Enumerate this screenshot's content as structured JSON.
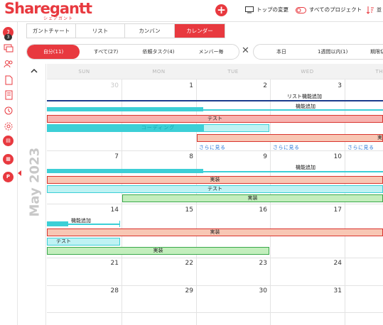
{
  "header": {
    "logo": "Sharegantt",
    "logo_sub": "シェアガント",
    "top_change_label": "トップの変更",
    "all_projects_label": "すべてのプロジェクト",
    "sort_label": "並"
  },
  "rail": {
    "badge_count": "3",
    "project_initial": "P"
  },
  "view_tabs": [
    {
      "label": "ガントチャート",
      "active": false
    },
    {
      "label": "リスト",
      "active": false
    },
    {
      "label": "カンバン",
      "active": false
    },
    {
      "label": "カレンダー",
      "active": true
    }
  ],
  "filter_tabs": [
    {
      "label": "自分(11)",
      "active": true
    },
    {
      "label": "すべて(27)",
      "active": false
    },
    {
      "label": "依頼タスク(4)",
      "active": false
    },
    {
      "label": "メンバー毎",
      "active": false
    }
  ],
  "date_filters": [
    {
      "label": "本日"
    },
    {
      "label": "1週間以内(1)"
    },
    {
      "label": "期限切"
    }
  ],
  "calendar": {
    "month_label": "May 2023",
    "weekdays": [
      "SUN",
      "MON",
      "TUE",
      "WED",
      "TH"
    ],
    "weeks": [
      {
        "days": [
          "30",
          "1",
          "2",
          "3"
        ],
        "muted": [
          true,
          false,
          false,
          false
        ]
      },
      {
        "days": [
          "7",
          "8",
          "9",
          "10"
        ],
        "muted": [
          false,
          false,
          false,
          false
        ]
      },
      {
        "days": [
          "14",
          "15",
          "16",
          "17"
        ],
        "muted": [
          false,
          false,
          false,
          false
        ]
      },
      {
        "days": [
          "21",
          "22",
          "23",
          "24"
        ],
        "muted": [
          false,
          false,
          false,
          false
        ]
      },
      {
        "days": [
          "28",
          "29",
          "30",
          "31"
        ],
        "muted": [
          false,
          false,
          false,
          false
        ]
      }
    ],
    "see_more": "さらに見る",
    "tasks": {
      "list_feature": "リスト機能追加",
      "feature_add": "機能追加",
      "test": "テスト",
      "coding": "コーディング",
      "impl": "実装",
      "impl_trunc": "実"
    }
  },
  "colors": {
    "brand_red": "#e8393f",
    "navy": "#1b3a8c",
    "cyan": "#3ccfd6",
    "pink_fill": "#f7b3b0",
    "salmon_fill": "#f8c7b4",
    "aqua_fill": "#bff2f3",
    "green_fill": "#c3eebd"
  }
}
